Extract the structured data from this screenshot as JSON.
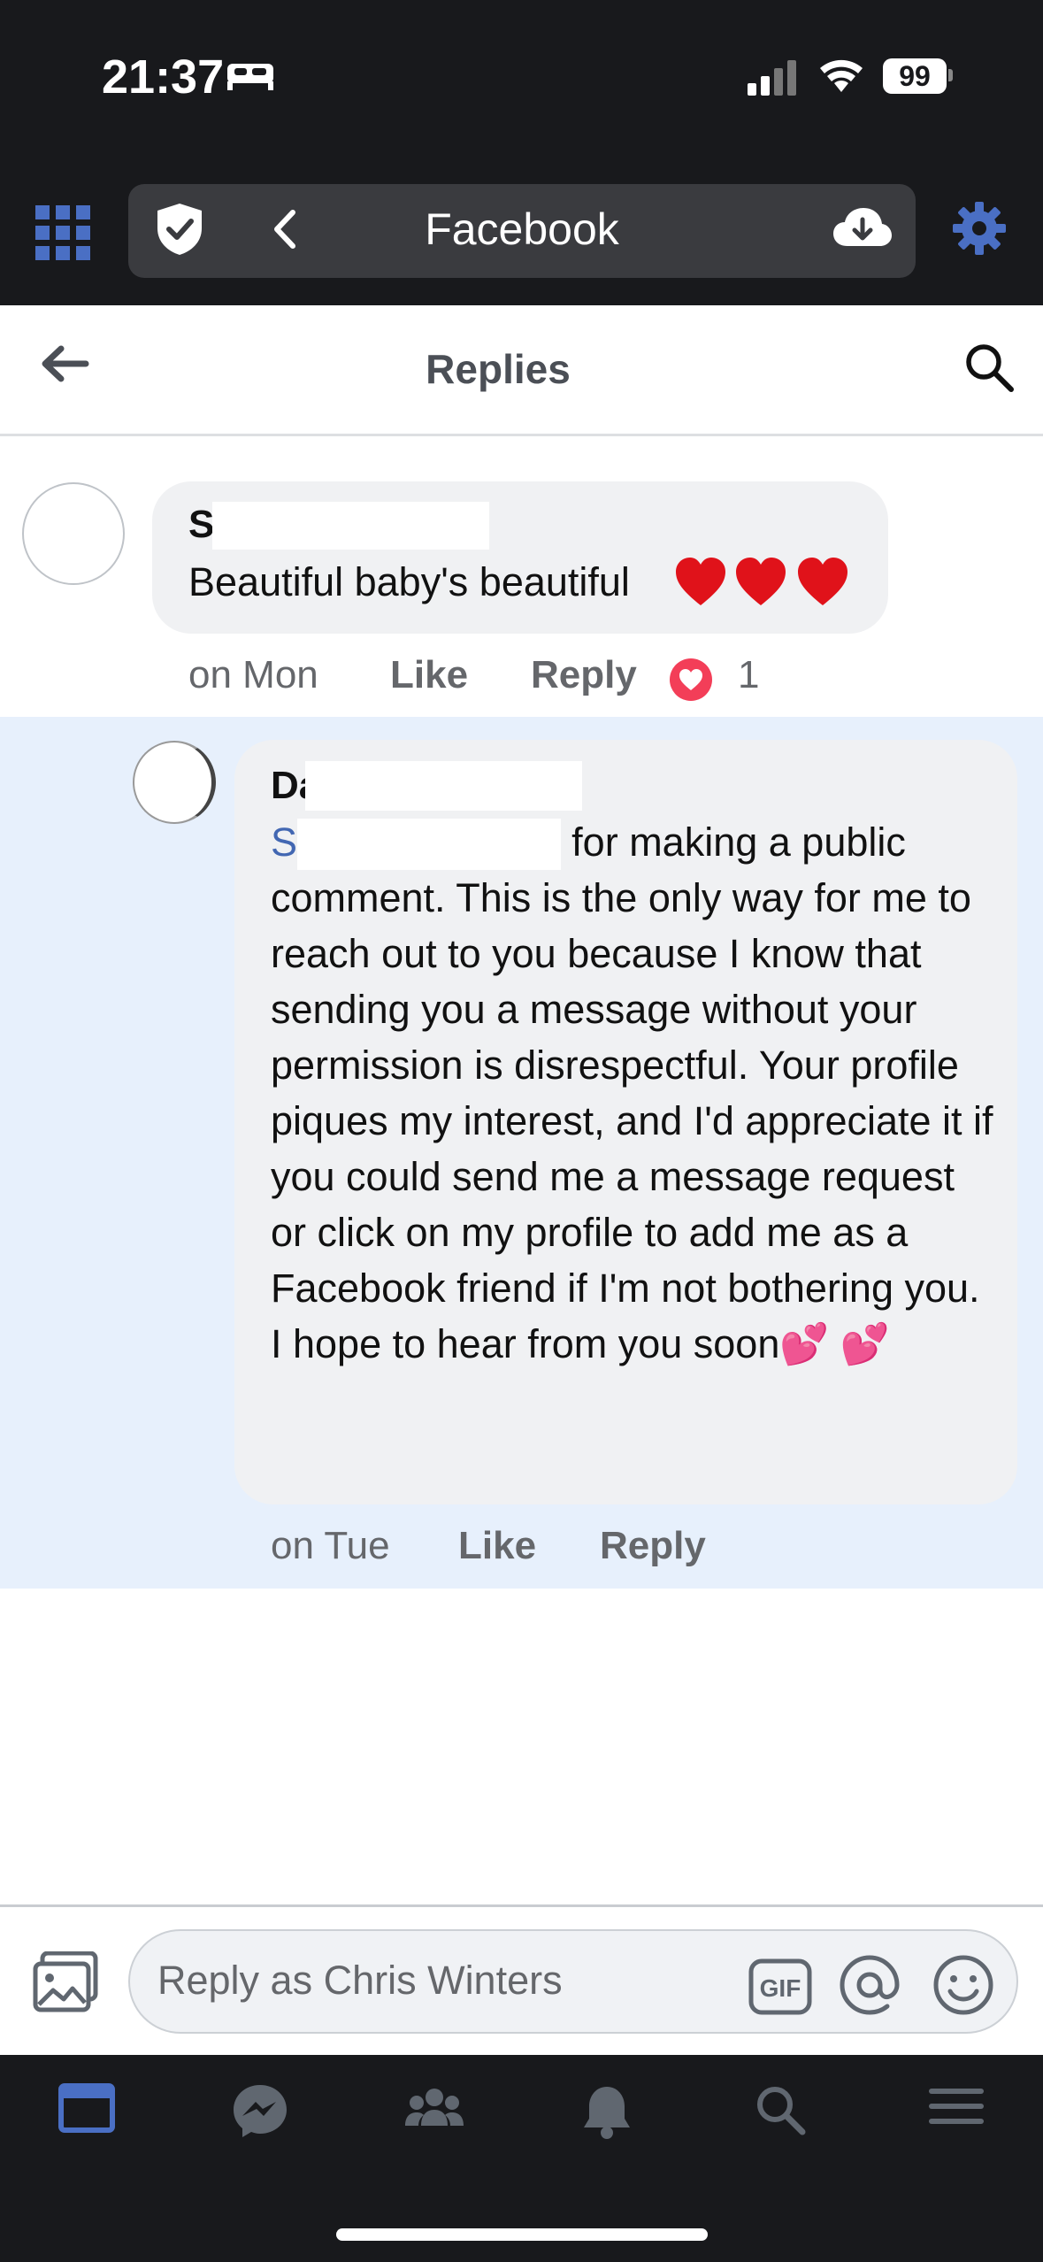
{
  "status_bar": {
    "time": "21:37",
    "battery": "99"
  },
  "browser": {
    "url_title": "Facebook"
  },
  "header": {
    "title": "Replies"
  },
  "comment1": {
    "name_initial": "S",
    "text": "Beautiful baby's beautiful",
    "emoji": "❤️❤️❤️",
    "time": "on Mon",
    "like_label": "Like",
    "reply_label": "Reply",
    "reaction_count": "1"
  },
  "comment2": {
    "name_initial": "Da",
    "mention_initial": "S",
    "text": " Hi, I apologize for making a public comment. This is the only way for me to reach out to you because I know that sending you a message without your permission is disrespectful. Your profile piques my interest, and I'd appreciate it if you could send me a message request or click on my profile to add me as a Facebook friend if I'm not bothering you. I hope to hear from you soon",
    "emoji": "💕 💕",
    "time": "on Tue",
    "like_label": "Like",
    "reply_label": "Reply"
  },
  "composer": {
    "placeholder": "Reply as Chris Winters",
    "gif_label": "GIF"
  },
  "colors": {
    "dark_bar": "#18191c",
    "accent": "#4267b2",
    "highlight": "#e7f0fc",
    "bubble": "#f0f1f3"
  }
}
